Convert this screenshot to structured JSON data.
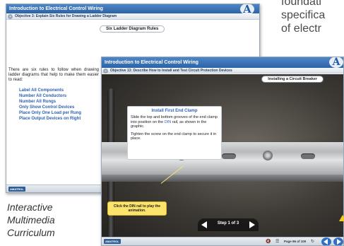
{
  "background_text": {
    "lines": [
      "foundati",
      "specifica",
      "of electr"
    ]
  },
  "caption": {
    "lines": [
      "Interactive",
      "Multimedia",
      "Curriculum"
    ]
  },
  "window1": {
    "title": "Introduction to Electrical Control Wiring",
    "objective": "Objective 3: Explain Six Rules for Drawing a Ladder Diagram",
    "logo_letter": "A",
    "section_title": "Six Ladder Diagram Rules",
    "intro": "There are six rules to follow when drawing ladder diagrams that help to make them easier to read:",
    "rules": [
      "Label All Components",
      "Number All Conductors",
      "Number All Rungs",
      "Only Show Control Devices",
      "Place Only One Load per Rung",
      "Place Output Devices on Right"
    ],
    "footer_logo": "AMATROL"
  },
  "window2": {
    "title": "Introduction to Electrical Control Wiring",
    "objective": "Objective 13: Describe How to Install and Test Circuit Protection Devices",
    "logo_letter": "A",
    "section_title": "Installing a Circuit Breaker",
    "tip": {
      "title": "Install First End Clamp",
      "para1_a": "Slide the top and bottom grooves of the end clamp into position on the ",
      "para1_hl": "DIN",
      "para1_b": " rail, as shown in the graphic.",
      "para2": "Tighten the screw on the end clamp to secure it in place."
    },
    "callout": "Click the DIN rail to play the animation.",
    "step_label": "Step 1 of 3",
    "footer_logo": "AMATROL",
    "page_label": "Page 96 of 100",
    "icons": {
      "mute": "mute-icon",
      "menu": "menu-icon",
      "refresh": "refresh-icon",
      "prev": "prev-page-icon",
      "next": "next-page-icon"
    }
  },
  "colors": {
    "titlebar": "#2c63a7",
    "rule_text": "#2d62b3",
    "callout_bg": "#fce36b",
    "nav_button": "#2f6fc6"
  }
}
